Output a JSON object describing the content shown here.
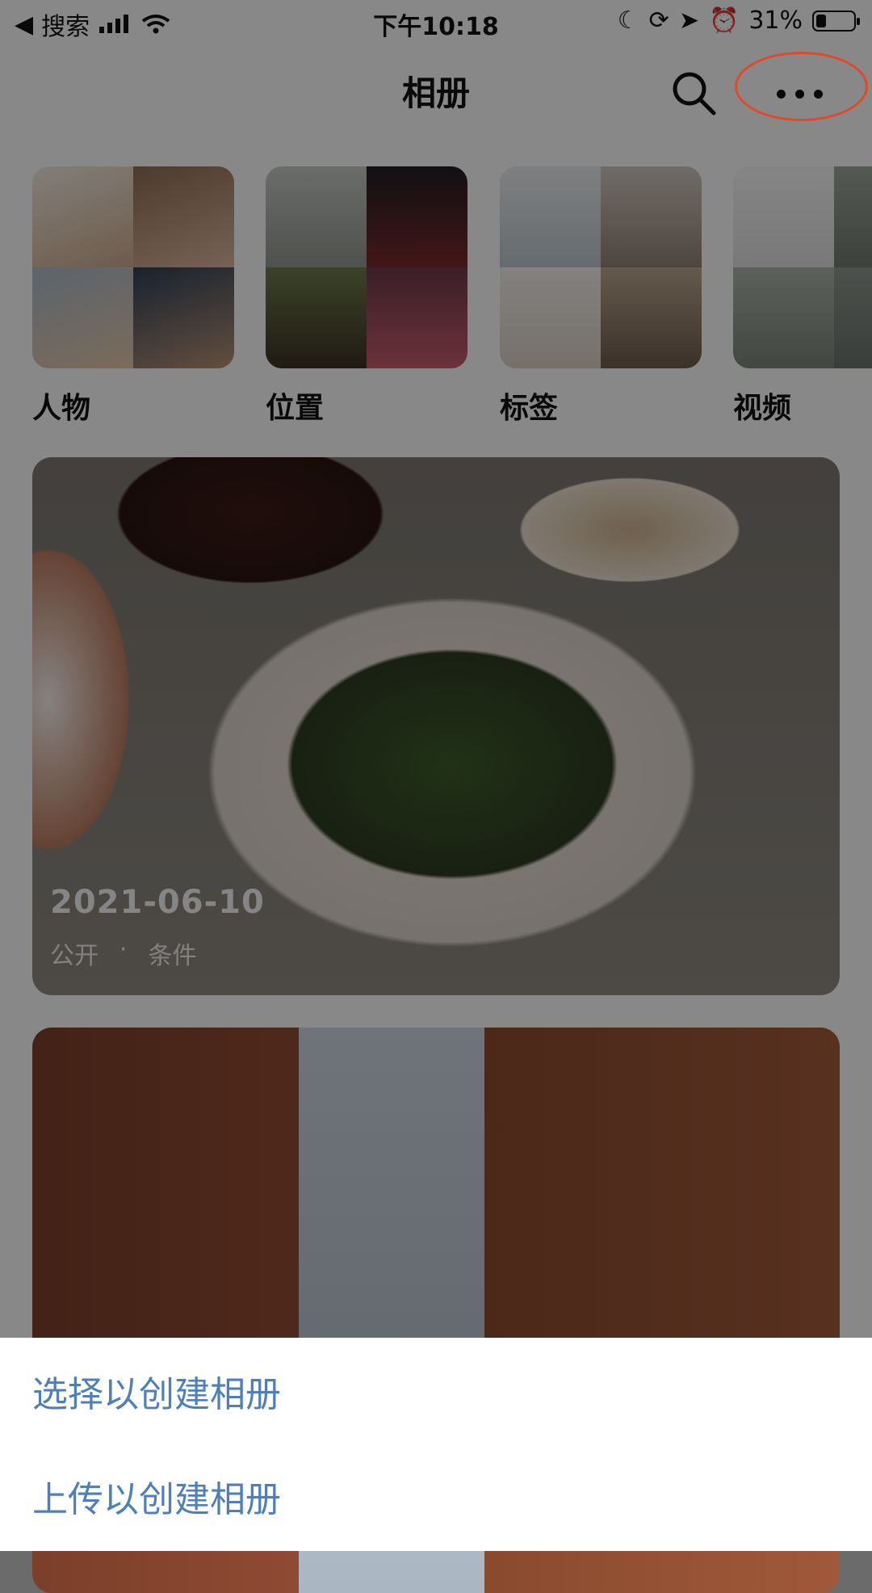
{
  "status_bar": {
    "back_app": "搜索",
    "time": "下午10:18",
    "battery_percent": "31%"
  },
  "nav": {
    "title": "相册"
  },
  "categories": [
    {
      "label": "人物"
    },
    {
      "label": "位置"
    },
    {
      "label": "标签"
    },
    {
      "label": "视频"
    }
  ],
  "albums": [
    {
      "date": "2021-06-10",
      "visibility": "公开",
      "separator": "·",
      "type": "条件"
    },
    {
      "date": "",
      "visibility": "",
      "separator": "",
      "type": ""
    }
  ],
  "sheet": {
    "items": [
      {
        "label": "选择以创建相册"
      },
      {
        "label": "上传以创建相册"
      }
    ]
  },
  "colors": {
    "sheet_text": "#4f7fb8",
    "highlight": "#e04a2a"
  }
}
